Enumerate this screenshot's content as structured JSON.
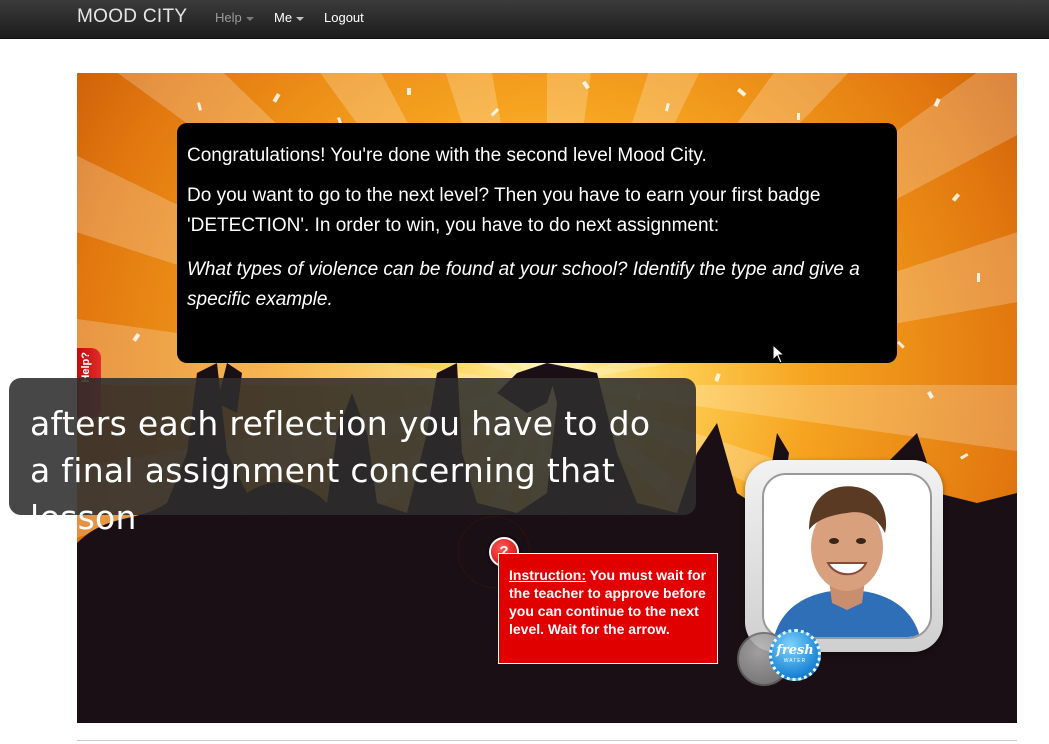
{
  "navbar": {
    "brand": "MOOD CITY",
    "items": [
      {
        "label": "Help",
        "dropdown": true
      },
      {
        "label": "Me",
        "dropdown": true
      },
      {
        "label": "Logout",
        "dropdown": false
      }
    ]
  },
  "dialog": {
    "line1": "Congratulations! You're done with the second level Mood City.",
    "line2": "Do you want to go to the next level? Then you have to earn your first badge 'DETECTION'. In order to win, you have to do next assignment:",
    "assignment": "What types of violence can be found at your school? Identify the type and give a specific example."
  },
  "caption": {
    "text": "afters each reflection you have to do a final assignment concerning that lesson"
  },
  "side_tab": {
    "label": "Help?"
  },
  "question_marker": {
    "symbol": "?"
  },
  "instruction": {
    "label": "Instruction:",
    "text": " You must wait for the teacher to approve before you can continue to the next level. Wait for the arrow."
  },
  "badge": {
    "title": "fresh",
    "subtitle": "WATER"
  },
  "colors": {
    "navbar": "#222222",
    "scene_orange": "#f6a420",
    "dialog_bg": "#000000",
    "instruction_red": "#e00000",
    "badge_blue": "#1d86d6"
  }
}
